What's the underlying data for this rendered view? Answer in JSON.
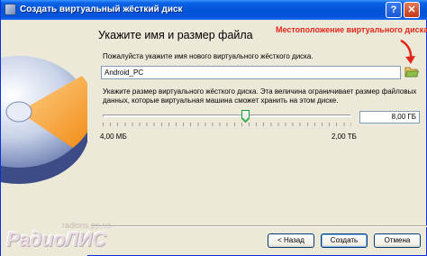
{
  "window": {
    "title": "Создать виртуальный жёсткий диск",
    "help_button": "?",
    "close_button": "✕"
  },
  "page": {
    "heading": "Укажите имя и размер файла",
    "annotation": "Местоположение виртуального диска",
    "name_prompt": "Пожалуйста укажите имя нового виртуального жёсткого диска.",
    "name_value": "Android_PC",
    "size_prompt_line1": "Укажите размер виртуального жёсткого диска. Эта величина ограничивает размер файловых",
    "size_prompt_line2": "данных, которые виртуальная машина сможет хранить на этом диске.",
    "size_value": "8,00 ГБ",
    "size_level": 0.573,
    "min_label": "4,00 МБ",
    "max_label": "2,00 ТБ"
  },
  "buttons": {
    "back": "< Назад",
    "create": "Создать",
    "cancel": "Отмена"
  },
  "watermark": {
    "url": "radions.pp.ua",
    "logo": "РадиоЛИС"
  },
  "colors": {
    "titlebar": "#0553d5",
    "annotation": "#e3261b",
    "dialog_bg": "#ece9d8"
  },
  "icons": {
    "title": "disk-icon",
    "folder": "folder-open-icon",
    "arrow": "red-arrow-icon"
  }
}
